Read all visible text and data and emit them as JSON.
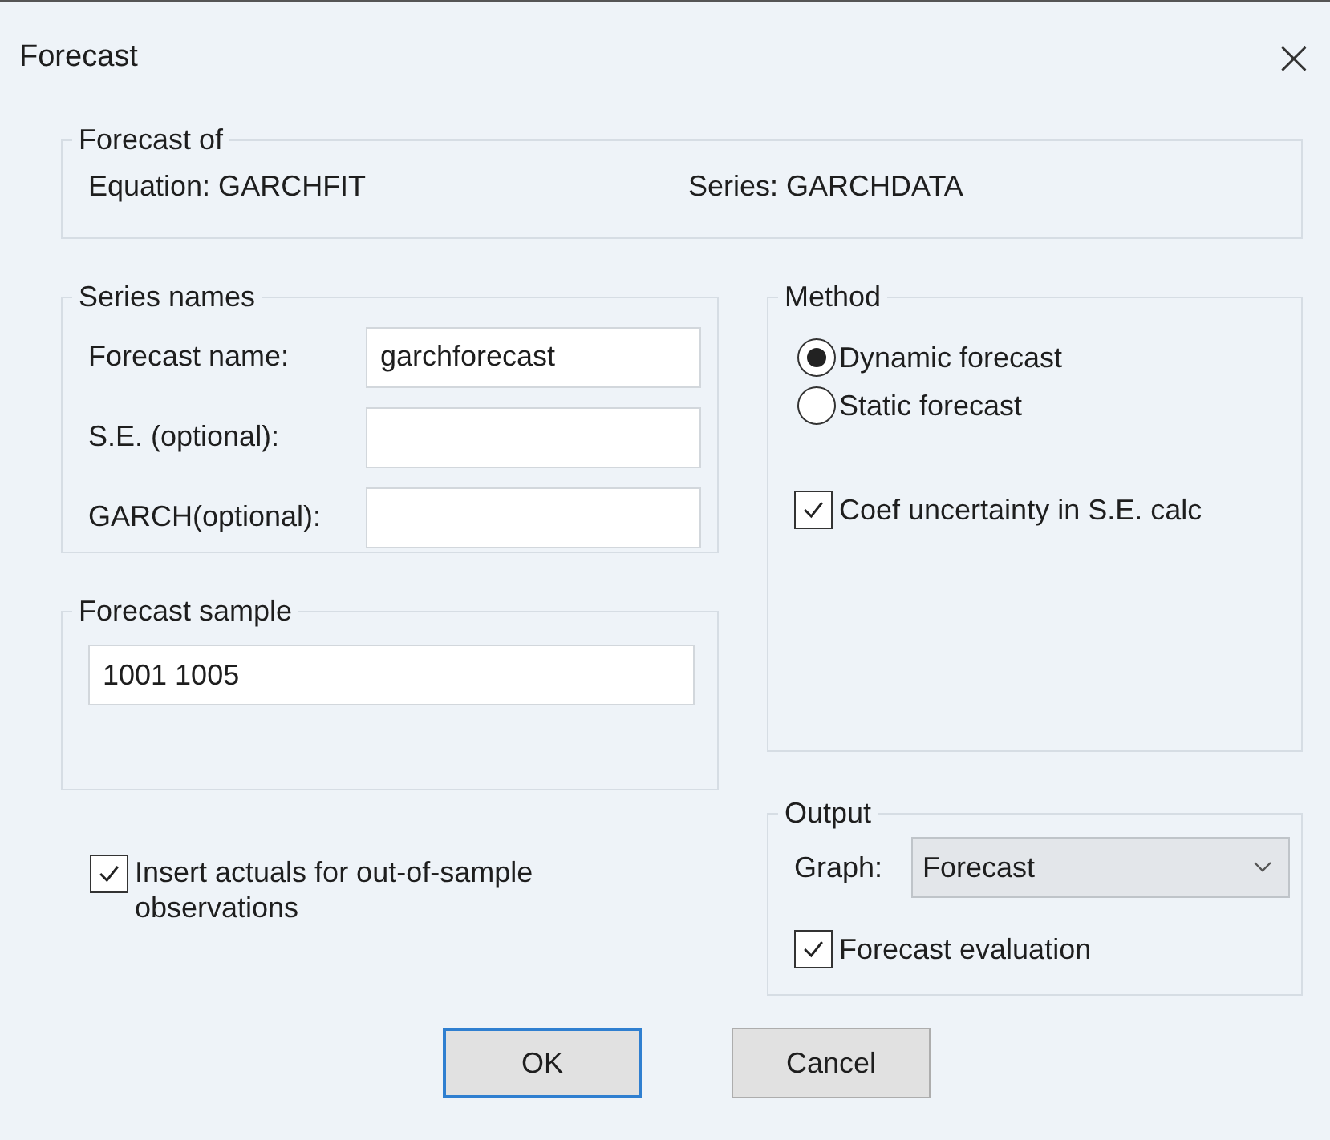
{
  "window": {
    "title": "Forecast",
    "close": "×"
  },
  "forecast_of": {
    "legend": "Forecast of",
    "equation": "Equation: GARCHFIT",
    "series": "Series: GARCHDATA"
  },
  "series_names": {
    "legend": "Series names",
    "fields": [
      {
        "label": "Forecast name:",
        "value": "garchforecast"
      },
      {
        "label": "S.E. (optional):"
      },
      {
        "label": "GARCH(optional):"
      }
    ]
  },
  "forecast_sample": {
    "legend": "Forecast sample",
    "value": "1001 1005"
  },
  "insert_actuals": {
    "label": "Insert actuals for out-of-sample observations",
    "checked": true
  },
  "method": {
    "legend": "Method",
    "options": [
      {
        "label": "Dynamic forecast",
        "selected": true
      },
      {
        "label": "Static forecast",
        "selected": false
      }
    ],
    "coef_uncertainty": {
      "label": "Coef uncertainty in S.E. calc",
      "checked": true
    }
  },
  "output": {
    "legend": "Output",
    "graph_label": "Graph:",
    "graph_value": "Forecast",
    "evaluation": {
      "label": "Forecast evaluation",
      "checked": true
    }
  },
  "buttons": [
    {
      "label": "OK",
      "default": true
    },
    {
      "label": "Cancel",
      "default": false
    }
  ]
}
